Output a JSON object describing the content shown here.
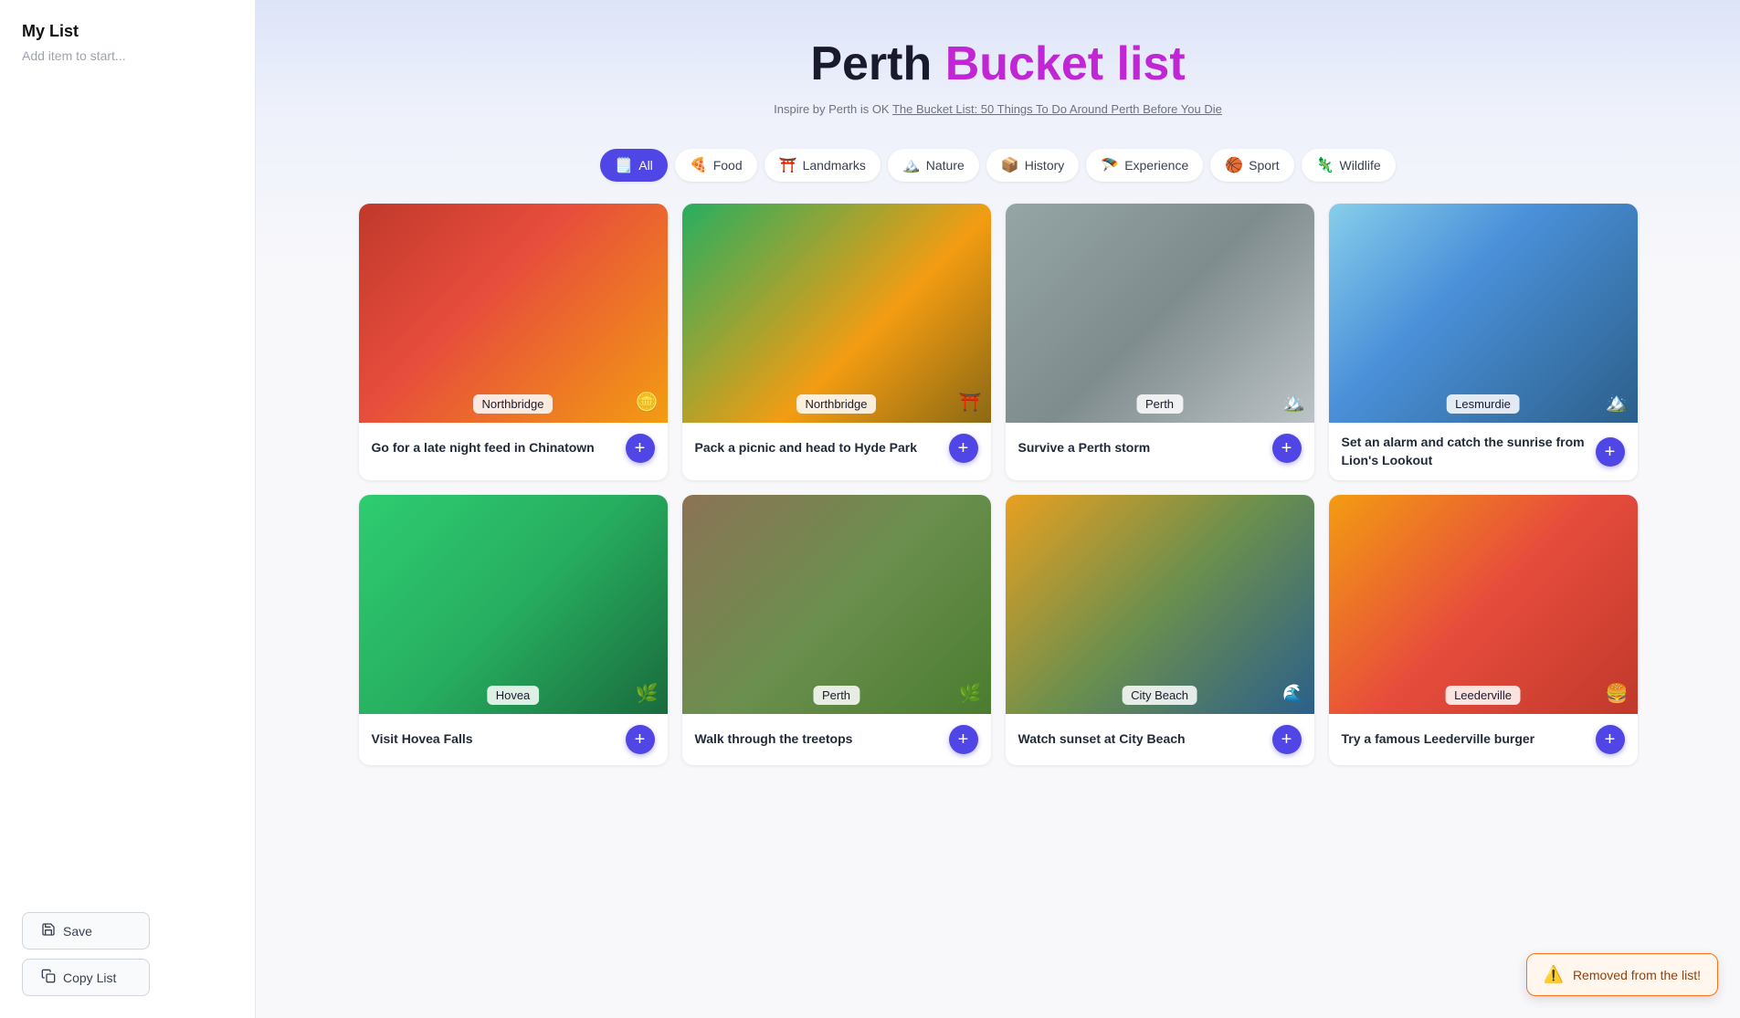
{
  "sidebar": {
    "title": "My List",
    "subtitle": "Add item to start...",
    "save_label": "Save",
    "copy_label": "Copy List"
  },
  "hero": {
    "title_part1": "Perth ",
    "title_part2": "Bucket list",
    "subtitle": "Inspire by Perth is OK ",
    "link_text": "The Bucket List: 50 Things To Do Around Perth Before You Die"
  },
  "filters": [
    {
      "id": "all",
      "label": "All",
      "icon": "🗒️",
      "active": true
    },
    {
      "id": "food",
      "label": "Food",
      "icon": "🍕",
      "active": false
    },
    {
      "id": "landmarks",
      "label": "Landmarks",
      "icon": "⛩️",
      "active": false
    },
    {
      "id": "nature",
      "label": "Nature",
      "icon": "🏔️",
      "active": false
    },
    {
      "id": "history",
      "label": "History",
      "icon": "📦",
      "active": false
    },
    {
      "id": "experience",
      "label": "Experience",
      "icon": "🪂",
      "active": false
    },
    {
      "id": "sport",
      "label": "Sport",
      "icon": "🏀",
      "active": false
    },
    {
      "id": "wildlife",
      "label": "Wildlife",
      "icon": "🦎",
      "active": false
    }
  ],
  "cards": [
    {
      "id": 1,
      "title": "Go for a late night feed in Chinatown",
      "location": "Northbridge",
      "category_icon": "🪙",
      "bg_class": "bg-chinatown"
    },
    {
      "id": 2,
      "title": "Pack a picnic and head to Hyde Park",
      "location": "Northbridge",
      "category_icon": "⛩️",
      "bg_class": "bg-hydepark"
    },
    {
      "id": 3,
      "title": "Survive a Perth storm",
      "location": "Perth",
      "category_icon": "🏔️",
      "bg_class": "bg-storm"
    },
    {
      "id": 4,
      "title": "Set an alarm and catch the sunrise from Lion's Lookout",
      "location": "Lesmurdie",
      "category_icon": "🏔️",
      "bg_class": "bg-sunrise"
    },
    {
      "id": 5,
      "title": "Visit Hovea Falls",
      "location": "Hovea",
      "category_icon": "🌿",
      "bg_class": "bg-hovea"
    },
    {
      "id": 6,
      "title": "Walk through the treetops",
      "location": "Perth",
      "category_icon": "🌿",
      "bg_class": "bg-perth-walk"
    },
    {
      "id": 7,
      "title": "Watch sunset at City Beach",
      "location": "City Beach",
      "category_icon": "🌊",
      "bg_class": "bg-citybeach"
    },
    {
      "id": 8,
      "title": "Try a famous Leederville burger",
      "location": "Leederville",
      "category_icon": "🍔",
      "bg_class": "bg-leederville"
    }
  ],
  "toast": {
    "icon": "⚠️",
    "message": "Removed from the list!"
  }
}
